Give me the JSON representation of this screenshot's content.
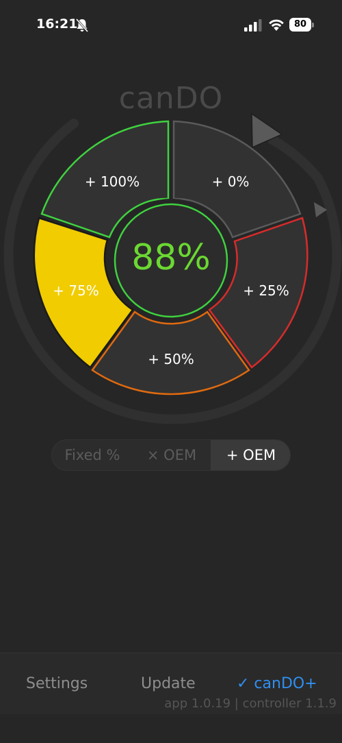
{
  "status_bar": {
    "time": "16:21",
    "battery": "80",
    "icons": [
      "bell-slash-icon",
      "signal-icon",
      "wifi-icon",
      "battery-icon"
    ]
  },
  "app": {
    "title": "canDO"
  },
  "dial": {
    "center_value": "88%",
    "segments": [
      {
        "label": "+ 0%",
        "color": "#555555",
        "fill": "#333333"
      },
      {
        "label": "+ 25%",
        "color": "#d82b2b",
        "fill": "#333333"
      },
      {
        "label": "+ 50%",
        "color": "#e06a10",
        "fill": "#333333"
      },
      {
        "label": "+ 75%",
        "color": "#111111",
        "fill": "#f0cc00"
      },
      {
        "label": "+ 100%",
        "color": "#3fd23f",
        "fill": "#333333"
      }
    ],
    "center_ring_color": "#3fd23f"
  },
  "mode_control": {
    "options": [
      "Fixed %",
      "× OEM",
      "+ OEM"
    ],
    "selected": "+ OEM"
  },
  "bottom_bar": {
    "settings_label": "Settings",
    "update_label": "Update",
    "cando_label": "✓ canDO+",
    "version": "app 1.0.19 | controller 1.1.9"
  },
  "colors": {
    "background": "#262626",
    "accent_blue": "#2f8ff0",
    "center_green": "#6bd832",
    "selected_yellow": "#f0cc00"
  }
}
